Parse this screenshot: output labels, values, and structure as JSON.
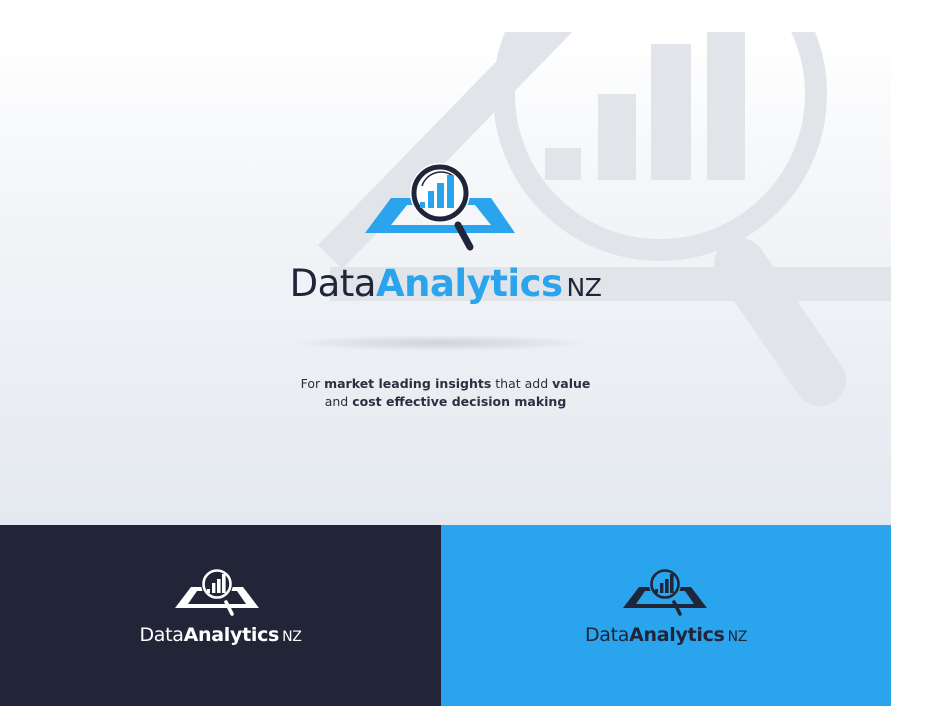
{
  "brand": {
    "name_prefix": "Data",
    "name_accent": "Analytics",
    "name_suffix": "NZ"
  },
  "tagline": {
    "line1": [
      {
        "text": "For ",
        "bold": false
      },
      {
        "text": "market leading insights",
        "bold": true
      },
      {
        "text": " that add ",
        "bold": false
      },
      {
        "text": "value",
        "bold": true
      }
    ],
    "line2": [
      {
        "text": "and ",
        "bold": false
      },
      {
        "text": "cost effective decision making",
        "bold": true
      }
    ]
  },
  "colors": {
    "navy": "#202639",
    "dark_panel": "#212537",
    "brand_blue": "#2aa4ec",
    "white": "#ffffff"
  },
  "icons": {
    "logo": "magnifier-over-bar-chart-icon",
    "background": "watermark-logo"
  }
}
